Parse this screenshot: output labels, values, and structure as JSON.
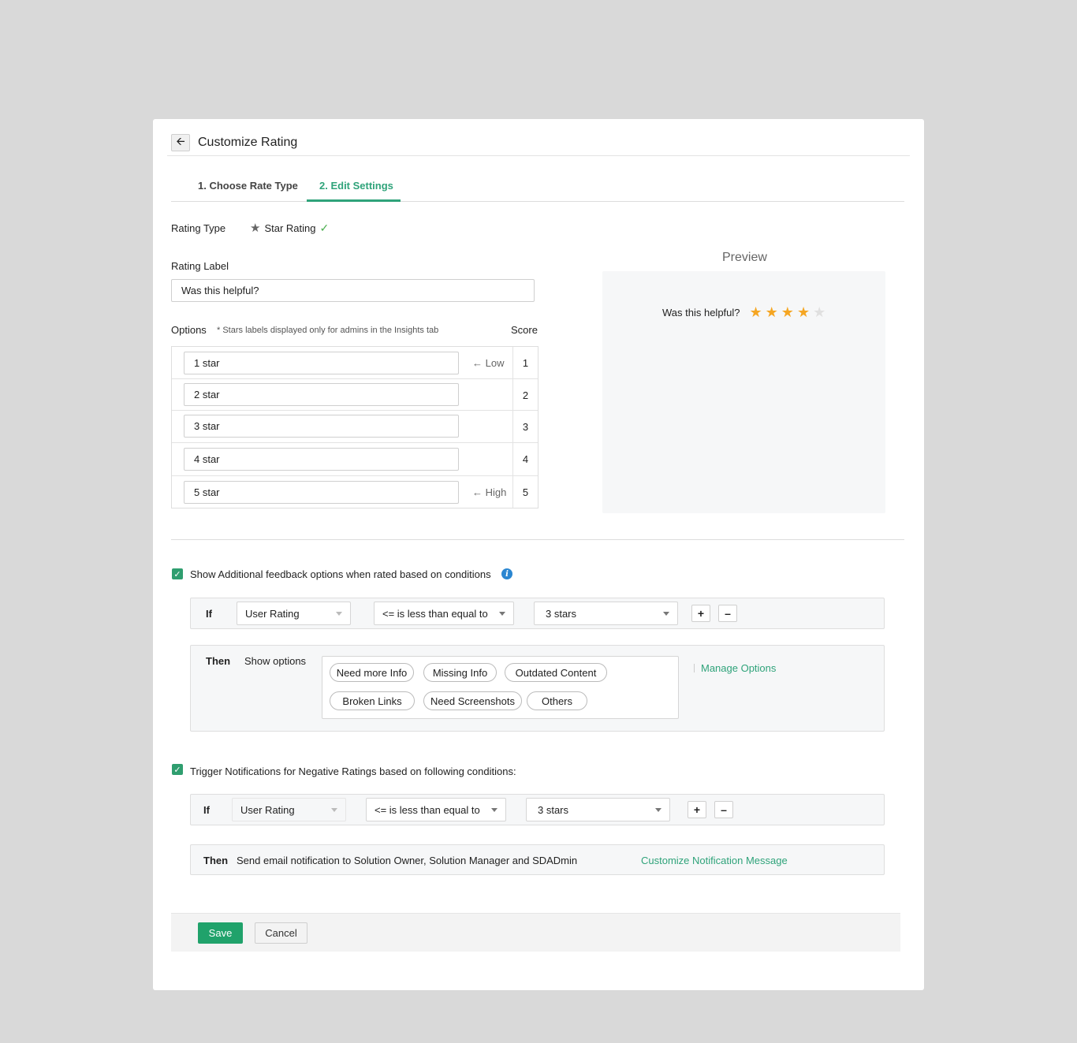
{
  "header": {
    "back_icon": "arrow-left-icon",
    "title": "Customize Rating"
  },
  "tabs": [
    {
      "label": "1.  Choose Rate Type",
      "active": false
    },
    {
      "label": "2. Edit Settings",
      "active": true
    }
  ],
  "rating_type": {
    "label": "Rating Type",
    "value": "Star Rating",
    "icon": "star-icon",
    "check_icon": "check-icon"
  },
  "rating_label": {
    "label": "Rating Label",
    "value": "Was this helpful?"
  },
  "options": {
    "label": "Options",
    "note": "* Stars labels displayed only for admins in the Insights tab",
    "score_header": "Score",
    "rows": [
      {
        "value": "1 star",
        "hint": "← Low",
        "score": "1"
      },
      {
        "value": "2 star",
        "hint": "",
        "score": "2"
      },
      {
        "value": "3 star",
        "hint": "",
        "score": "3"
      },
      {
        "value": "4 star",
        "hint": "",
        "score": "4"
      },
      {
        "value": "5 star",
        "hint": "← High",
        "score": "5"
      }
    ]
  },
  "preview": {
    "title": "Preview",
    "question": "Was this helpful?",
    "filled_stars": 4,
    "total_stars": 5
  },
  "feedback_section": {
    "checkbox_label": "Show Additional feedback options when rated based on conditions",
    "checked": true,
    "info_icon": "info-icon",
    "if_label": "If",
    "field": "User Rating",
    "operator": "<=  is less than equal to",
    "value": "3  stars",
    "add_label": "+",
    "remove_label": "–",
    "then_label": "Then",
    "show_options_label": "Show options",
    "chips": [
      "Need more Info",
      "Missing Info",
      "Outdated Content",
      "Broken Links",
      "Need Screenshots",
      "Others"
    ],
    "manage_link": "Manage Options"
  },
  "notify_section": {
    "checkbox_label": "Trigger Notifications for Negative Ratings based on following conditions:",
    "checked": true,
    "if_label": "If",
    "field": "User Rating",
    "operator": "<=  is less than equal to",
    "value": "3  stars",
    "add_label": "+",
    "remove_label": "–",
    "then_label": "Then",
    "message": "Send email notification to Solution Owner, Solution Manager and SDADmin",
    "customize_link": "Customize Notification Message"
  },
  "footer": {
    "save_label": "Save",
    "cancel_label": "Cancel"
  },
  "colors": {
    "accent": "#2fa37a",
    "save_button": "#20a26b",
    "star": "#f5a623",
    "info": "#2a86d1"
  }
}
